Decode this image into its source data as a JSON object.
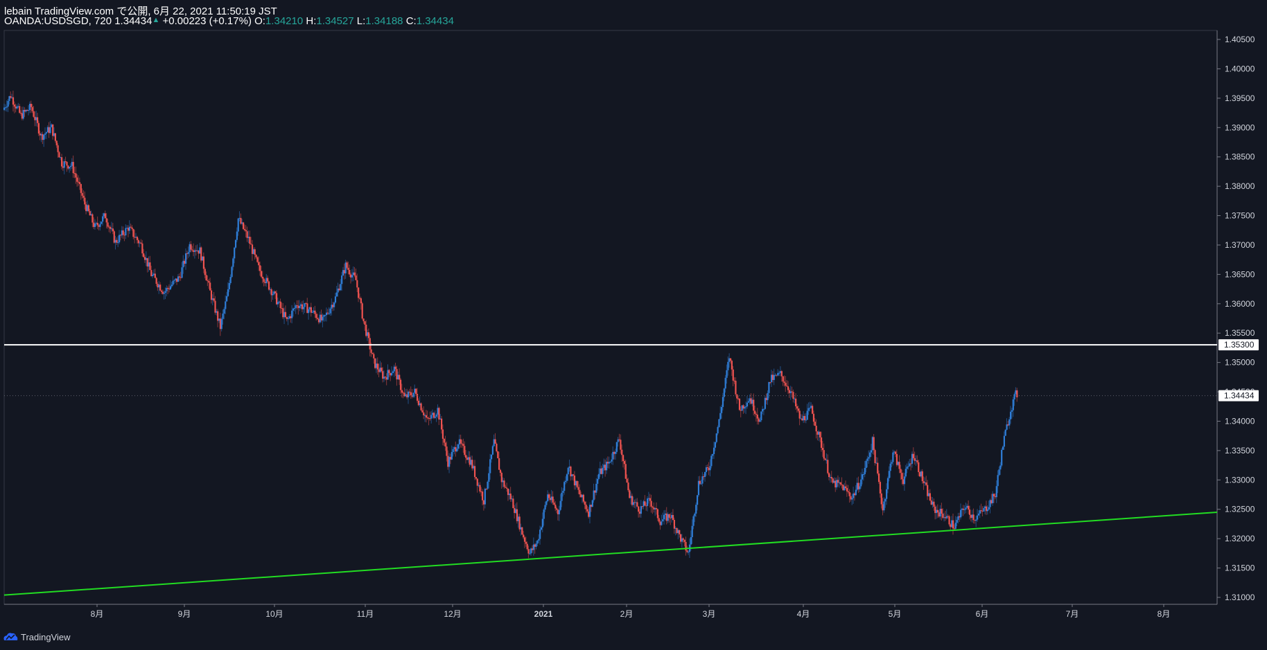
{
  "header": {
    "line1": "lebain TradingView.com で公開, 6月 22, 2021 11:50:19 JST",
    "symbol": "OANDA:USDSGD, 720",
    "last": "1.34434",
    "change": "+0.00223 (+0.17%)",
    "o_label": "O:",
    "o_value": "1.34210",
    "h_label": "H:",
    "h_value": "1.34527",
    "l_label": "L:",
    "l_value": "1.34188",
    "c_label": "C:",
    "c_value": "1.34434"
  },
  "footer": {
    "brand": "TradingView"
  },
  "colors": {
    "background": "#131722",
    "up": "#2f7ed8",
    "down": "#ef5350",
    "grid_text": "#d1d4dc",
    "support_line": "#22dd22",
    "resistance_line": "#ffffff",
    "accent_value": "#26a69a"
  },
  "chart_data": {
    "type": "candlestick",
    "title": "",
    "symbol": "OANDA:USDSGD",
    "interval": "720",
    "x_ticks": [
      "8月",
      "9月",
      "10月",
      "11月",
      "12月",
      "2021",
      "2月",
      "3月",
      "4月",
      "5月",
      "6月",
      "7月",
      "8月"
    ],
    "y_ticks": [
      "1.40500",
      "1.40000",
      "1.39500",
      "1.39000",
      "1.38500",
      "1.38000",
      "1.37500",
      "1.37000",
      "1.36500",
      "1.36000",
      "1.35500",
      "1.35000",
      "1.34500",
      "1.34000",
      "1.33500",
      "1.33000",
      "1.32500",
      "1.32000",
      "1.31500",
      "1.31000"
    ],
    "ylim": [
      1.3075,
      1.4075
    ],
    "grid": false,
    "price_labels": {
      "horizontal_line": "1.35300",
      "last_price": "1.34434"
    },
    "path_anchors": [
      [
        "2020-07-02",
        1.393
      ],
      [
        "2020-07-05",
        1.3955
      ],
      [
        "2020-07-09",
        1.392
      ],
      [
        "2020-07-13",
        1.3935
      ],
      [
        "2020-07-17",
        1.3885
      ],
      [
        "2020-07-21",
        1.39
      ],
      [
        "2020-07-25",
        1.384
      ],
      [
        "2020-07-29",
        1.3835
      ],
      [
        "2020-08-03",
        1.377
      ],
      [
        "2020-08-07",
        1.373
      ],
      [
        "2020-08-11",
        1.375
      ],
      [
        "2020-08-15",
        1.3705
      ],
      [
        "2020-08-20",
        1.373
      ],
      [
        "2020-08-25",
        1.37
      ],
      [
        "2020-08-29",
        1.365
      ],
      [
        "2020-09-03",
        1.362
      ],
      [
        "2020-09-09",
        1.3645
      ],
      [
        "2020-09-13",
        1.37
      ],
      [
        "2020-09-17",
        1.369
      ],
      [
        "2020-09-21",
        1.362
      ],
      [
        "2020-09-25",
        1.356
      ],
      [
        "2020-09-28",
        1.362
      ],
      [
        "2020-10-02",
        1.3745
      ],
      [
        "2020-10-06",
        1.371
      ],
      [
        "2020-10-10",
        1.366
      ],
      [
        "2020-10-16",
        1.3615
      ],
      [
        "2020-10-21",
        1.357
      ],
      [
        "2020-10-25",
        1.36
      ],
      [
        "2020-10-30",
        1.359
      ],
      [
        "2020-11-04",
        1.357
      ],
      [
        "2020-11-09",
        1.361
      ],
      [
        "2020-11-13",
        1.3665
      ],
      [
        "2020-11-17",
        1.364
      ],
      [
        "2020-11-20",
        1.357
      ],
      [
        "2020-11-24",
        1.35
      ],
      [
        "2020-11-28",
        1.3475
      ],
      [
        "2020-12-02",
        1.349
      ],
      [
        "2020-12-06",
        1.344
      ],
      [
        "2020-12-10",
        1.345
      ],
      [
        "2020-12-15",
        1.34
      ],
      [
        "2020-12-19",
        1.342
      ],
      [
        "2020-12-23",
        1.333
      ],
      [
        "2020-12-27",
        1.3365
      ],
      [
        "2021-01-01",
        1.333
      ],
      [
        "2021-01-06",
        1.3265
      ],
      [
        "2021-01-10",
        1.3365
      ],
      [
        "2021-01-13",
        1.33
      ],
      [
        "2021-01-17",
        1.3265
      ],
      [
        "2021-01-21",
        1.321
      ],
      [
        "2021-01-24",
        1.3175
      ],
      [
        "2021-01-27",
        1.3195
      ],
      [
        "2021-01-31",
        1.3275
      ],
      [
        "2021-02-04",
        1.3245
      ],
      [
        "2021-02-08",
        1.3325
      ],
      [
        "2021-02-12",
        1.328
      ],
      [
        "2021-02-16",
        1.3245
      ],
      [
        "2021-02-20",
        1.331
      ],
      [
        "2021-02-24",
        1.333
      ],
      [
        "2021-02-28",
        1.337
      ],
      [
        "2021-03-04",
        1.327
      ],
      [
        "2021-03-08",
        1.325
      ],
      [
        "2021-03-12",
        1.3265
      ],
      [
        "2021-03-16",
        1.323
      ],
      [
        "2021-03-20",
        1.324
      ],
      [
        "2021-03-24",
        1.32
      ],
      [
        "2021-03-27",
        1.3175
      ],
      [
        "2021-03-31",
        1.3295
      ],
      [
        "2021-04-04",
        1.332
      ],
      [
        "2021-04-08",
        1.34
      ],
      [
        "2021-04-12",
        1.351
      ],
      [
        "2021-04-16",
        1.342
      ],
      [
        "2021-04-20",
        1.344
      ],
      [
        "2021-04-24",
        1.34
      ],
      [
        "2021-04-28",
        1.347
      ],
      [
        "2021-05-02",
        1.348
      ],
      [
        "2021-05-06",
        1.345
      ],
      [
        "2021-05-10",
        1.34
      ],
      [
        "2021-05-14",
        1.342
      ],
      [
        "2021-05-18",
        1.336
      ],
      [
        "2021-05-22",
        1.3295
      ],
      [
        "2021-05-26",
        1.329
      ],
      [
        "2021-05-30",
        1.327
      ],
      [
        "2021-06-03",
        1.3305
      ],
      [
        "2021-06-07",
        1.3365
      ],
      [
        "2021-06-11",
        1.325
      ],
      [
        "2021-06-15",
        1.335
      ],
      [
        "2021-06-19",
        1.33
      ],
      [
        "2021-06-23",
        1.3345
      ],
      [
        "2021-06-27",
        1.3295
      ],
      [
        "2021-07-01",
        1.325
      ],
      [
        "2021-07-05",
        1.324
      ],
      [
        "2021-07-09",
        1.322
      ],
      [
        "2021-07-13",
        1.3255
      ],
      [
        "2021-07-17",
        1.3235
      ],
      [
        "2021-07-21",
        1.325
      ],
      [
        "2021-07-25",
        1.3275
      ],
      [
        "2021-07-28",
        1.336
      ],
      [
        "2021-07-31",
        1.342
      ],
      [
        "2021-08-02",
        1.3445
      ]
    ],
    "annotations": [
      {
        "type": "horizontal_line",
        "price": 1.353,
        "color": "#ffffff"
      },
      {
        "type": "trend_line",
        "points": [
          [
            "2020-07-02",
            1.3104
          ],
          [
            "2021-09-11",
            1.3245
          ]
        ],
        "color": "#22dd22"
      }
    ]
  }
}
